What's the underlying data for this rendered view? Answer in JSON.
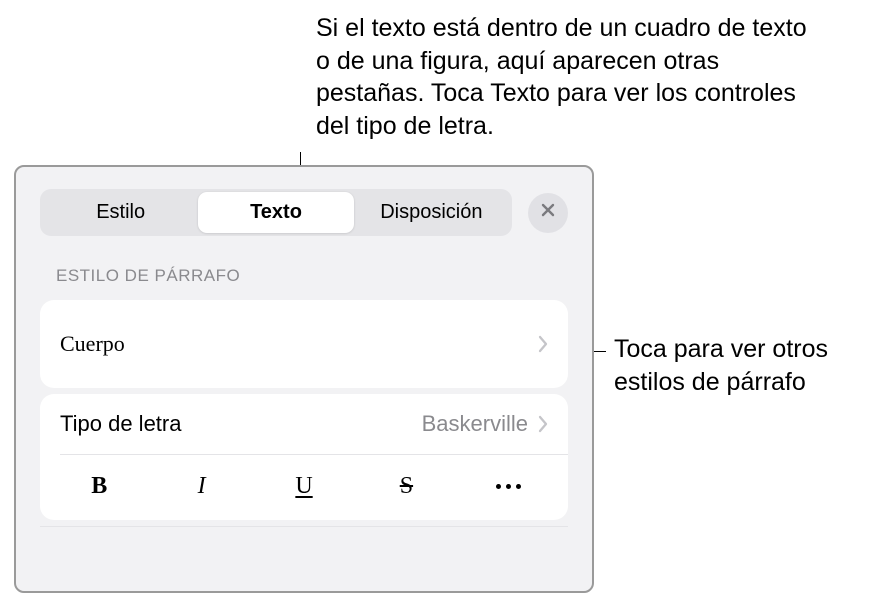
{
  "annotations": {
    "top": "Si el texto está dentro de un cuadro de texto o de una figura, aquí aparecen otras pestañas. Toca Texto para ver los controles del tipo de letra.",
    "right": "Toca para ver otros estilos de párrafo"
  },
  "tabs": {
    "style": "Estilo",
    "text": "Texto",
    "layout": "Disposición"
  },
  "sections": {
    "paragraph_style": "ESTILO DE PÁRRAFO"
  },
  "paragraph": {
    "current": "Cuerpo"
  },
  "font": {
    "label": "Tipo de letra",
    "value": "Baskerville"
  },
  "style_buttons": {
    "bold": "B",
    "italic": "I",
    "underline": "U",
    "strike": "S"
  }
}
